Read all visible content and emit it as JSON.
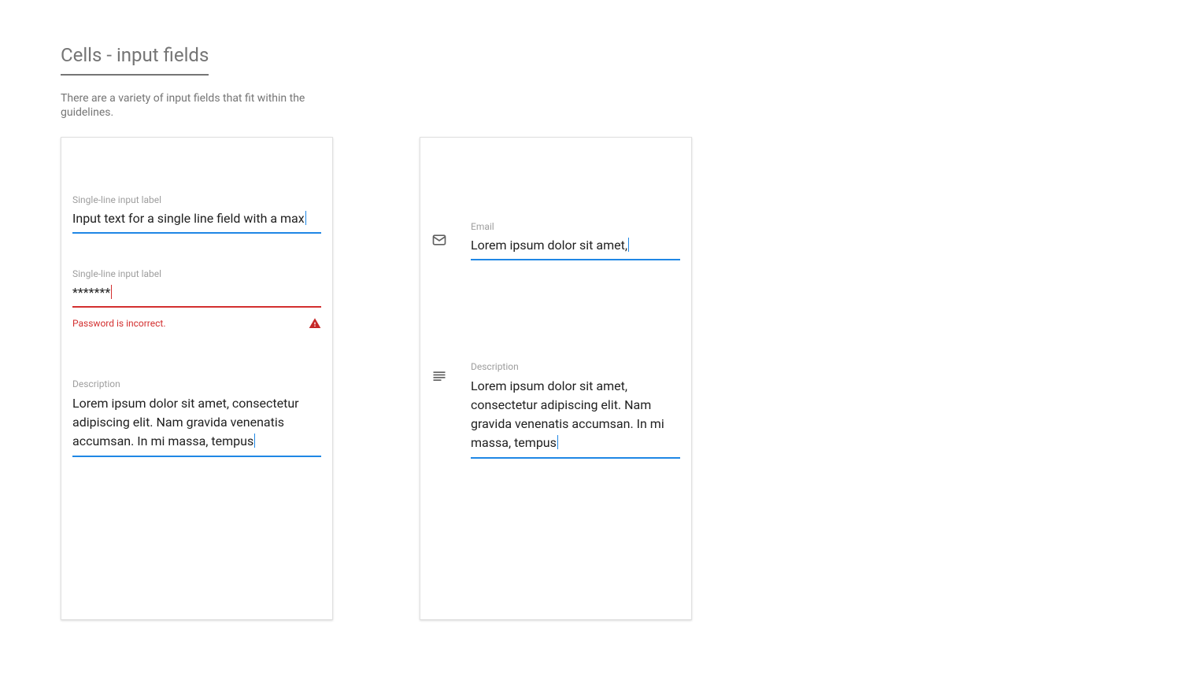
{
  "header": {
    "title": "Cells - input fields",
    "intro": "There are a variety of input fields that fit within the guidelines."
  },
  "card1": {
    "field1": {
      "label": "Single-line input label",
      "value": "Input text for a single line field with a max"
    },
    "field2": {
      "label": "Single-line input label",
      "value": "*******",
      "error": "Password is incorrect."
    },
    "field3": {
      "label": "Description",
      "value": "Lorem ipsum dolor sit amet, consectetur adipiscing elit. Nam gravida venenatis accumsan. In mi massa, tempus"
    }
  },
  "card2": {
    "email": {
      "label": "Email",
      "value": "Lorem ipsum dolor sit amet,"
    },
    "description": {
      "label": "Description",
      "value": "Lorem ipsum dolor sit amet, consectetur adipiscing elit. Nam gravida venenatis accumsan. In mi massa, tempus"
    }
  },
  "icons": {
    "mail": "mail-icon",
    "text": "text-lines-icon",
    "warning": "warning-icon"
  }
}
